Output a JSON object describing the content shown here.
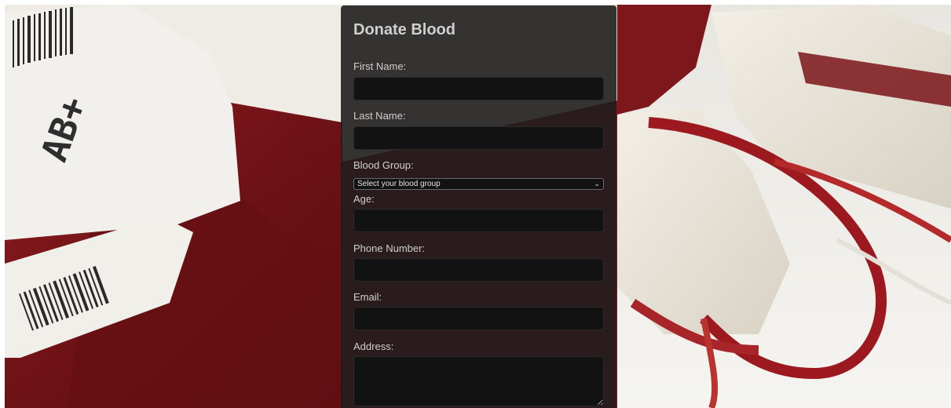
{
  "form": {
    "title": "Donate Blood",
    "fields": {
      "first_name": {
        "label": "First Name:",
        "value": "",
        "placeholder": ""
      },
      "last_name": {
        "label": "Last Name:",
        "value": "",
        "placeholder": ""
      },
      "blood_group": {
        "label": "Blood Group:",
        "selected": "Select your blood group"
      },
      "age": {
        "label": "Age:",
        "value": "",
        "placeholder": ""
      },
      "phone": {
        "label": "Phone Number:",
        "value": "",
        "placeholder": ""
      },
      "email": {
        "label": "Email:",
        "value": "",
        "placeholder": ""
      },
      "address": {
        "label": "Address:",
        "value": "",
        "placeholder": ""
      }
    }
  },
  "background": {
    "description_icon": "blood-bag-photo",
    "bag_label_text": "AB+"
  },
  "colors": {
    "panel": "#1c1c1c",
    "input": "#121212",
    "text": "#cfcfcf",
    "blood": "#7a1418"
  }
}
